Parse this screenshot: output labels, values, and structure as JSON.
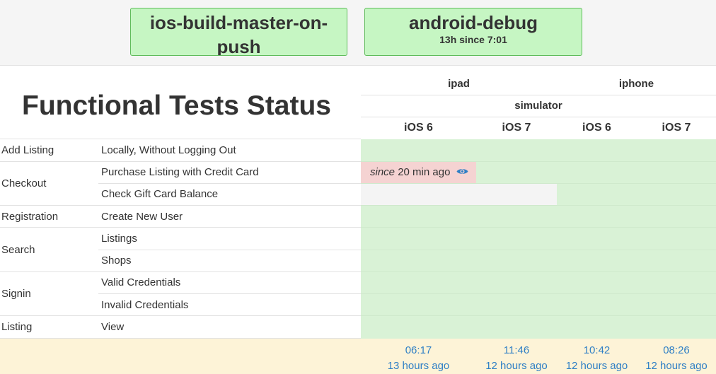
{
  "builds": [
    {
      "name": "ios-build-master-on-push",
      "time": ""
    },
    {
      "name": "android-debug",
      "time": "13h since 7:01"
    }
  ],
  "page_title": "Functional Tests Status",
  "header": {
    "devices": [
      "ipad",
      "iphone"
    ],
    "platform": "simulator",
    "os_versions": [
      "iOS 6",
      "iOS 7",
      "iOS 6",
      "iOS 7"
    ]
  },
  "rows": [
    {
      "category": "Add Listing",
      "test": "Locally, Without Logging Out"
    },
    {
      "category": "Checkout",
      "test": "Purchase Listing with Credit Card"
    },
    {
      "category": "",
      "test": "Check Gift Card Balance"
    },
    {
      "category": "Registration",
      "test": "Create New User"
    },
    {
      "category": "Search",
      "test": "Listings"
    },
    {
      "category": "",
      "test": "Shops"
    },
    {
      "category": "Signin",
      "test": "Valid Credentials"
    },
    {
      "category": "",
      "test": "Invalid Credentials"
    },
    {
      "category": "Listing",
      "test": "View"
    }
  ],
  "failure": {
    "since_label": "since",
    "duration": "20 min ago"
  },
  "footer_times": [
    {
      "time": "06:17",
      "ago": "13 hours ago"
    },
    {
      "time": "11:46",
      "ago": "12 hours ago"
    },
    {
      "time": "10:42",
      "ago": "12 hours ago"
    },
    {
      "time": "08:26",
      "ago": "12 hours ago"
    }
  ],
  "colors": {
    "build_ok_bg": "#c6f6c3",
    "build_ok_border": "#5fbb5b",
    "pass": "#d9f2d6",
    "fail": "#f5d3d2",
    "missing": "#f4f4f4",
    "footer_bg": "#fdf3d7",
    "link": "#2f7fc5"
  },
  "icons": {
    "failure_detail": "eye-icon"
  }
}
